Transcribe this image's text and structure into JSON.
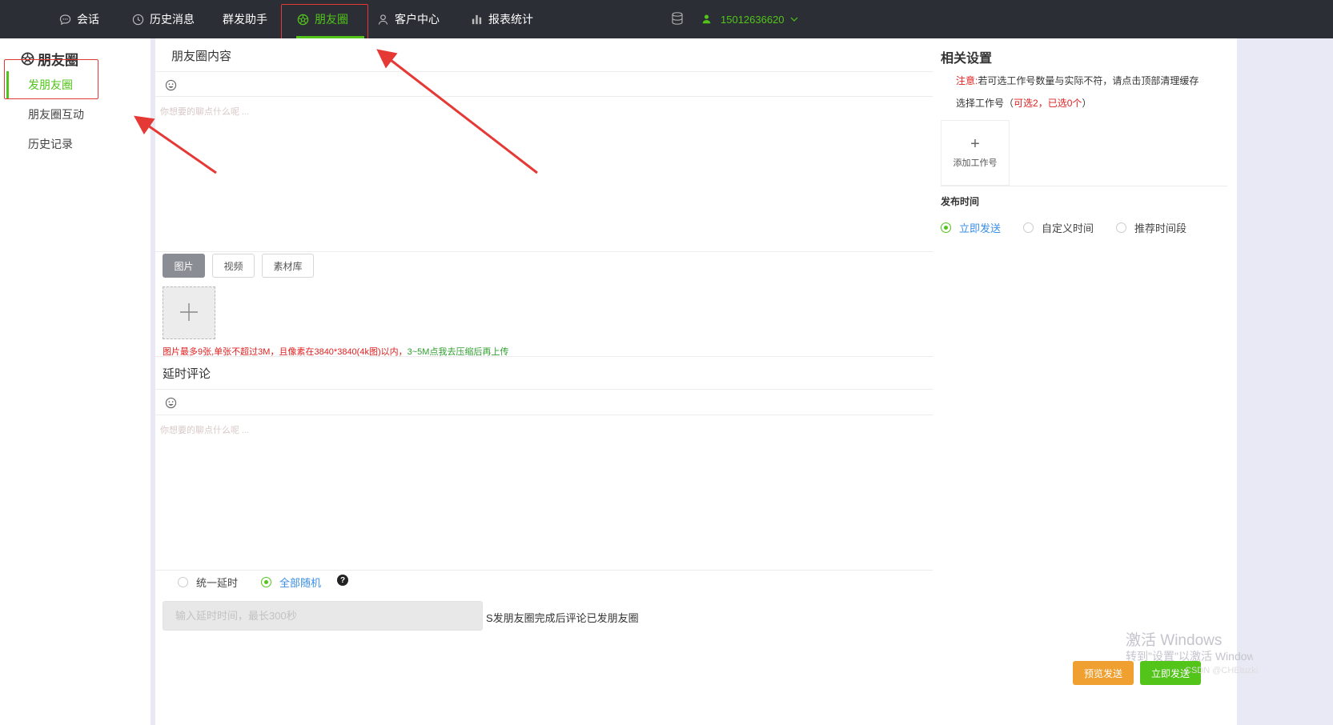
{
  "nav": {
    "items": [
      {
        "label": "会话",
        "icon": "chat-icon"
      },
      {
        "label": "历史消息",
        "icon": "clock-icon"
      },
      {
        "label": "群发助手",
        "icon": ""
      },
      {
        "label": "朋友圈",
        "icon": "moments-icon",
        "active": true
      },
      {
        "label": "客户中心",
        "icon": "user-icon"
      },
      {
        "label": "报表统计",
        "icon": "bar-chart-icon"
      }
    ],
    "account": "15012636620"
  },
  "sidebar": {
    "title": "朋友圈",
    "items": [
      {
        "label": "发朋友圈",
        "active": true
      },
      {
        "label": "朋友圈互动"
      },
      {
        "label": "历史记录"
      }
    ]
  },
  "content": {
    "title": "朋友圈内容",
    "placeholder": "你想要的聊点什么呢 ...",
    "media_tabs": [
      "图片",
      "视频",
      "素材库"
    ],
    "hint_red": "图片最多9张,单张不超过3M，且像素在3840*3840(4k图)以内，",
    "hint_green": "3~5M点我去压缩后再上传"
  },
  "comment": {
    "title": "延时评论",
    "placeholder": "你想要的聊点什么呢 ...",
    "options": [
      "统一延时",
      "全部随机"
    ],
    "selected": "全部随机",
    "delay_placeholder": "输入延时时间，最长300秒",
    "delay_suffix": "S发朋友圈完成后评论已发朋友圈"
  },
  "settings": {
    "title": "相关设置",
    "notice_label": "注意:",
    "notice_text": "若可选工作号数量与实际不符，请点击顶部清理缓存",
    "choose_label": "选择工作号（",
    "choose_count": "可选2，已选0个",
    "choose_end": "）",
    "add_label": "添加工作号",
    "publish_label": "发布时间",
    "publish_options": [
      "立即发送",
      "自定义时间",
      "推荐时间段"
    ],
    "publish_selected": "立即发送"
  },
  "footer": {
    "preview_label": "预览发送",
    "send_label": "立即发送"
  },
  "watermark": {
    "line1": "激活 Windows",
    "line2": "转到\"设置\"以激活 Windows。",
    "csdn": "CSDN @CHEtuzki"
  },
  "colors": {
    "accent": "#52c41a",
    "topbar": "#2b2e35",
    "highlight": "#e53935",
    "link": "#3a8ee6",
    "orange": "#f0a030"
  }
}
